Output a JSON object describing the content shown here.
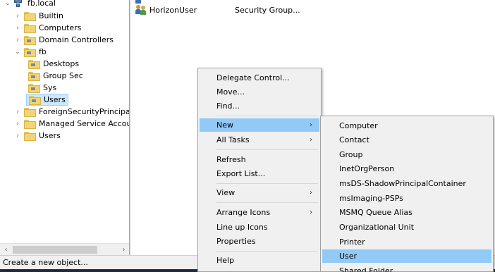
{
  "tree": {
    "domain": "fb.local",
    "items": [
      {
        "label": "Builtin"
      },
      {
        "label": "Computers"
      },
      {
        "label": "Domain Controllers"
      },
      {
        "label": "fb"
      },
      {
        "label": "Desktops"
      },
      {
        "label": "Group Sec"
      },
      {
        "label": "Sys"
      },
      {
        "label": "Users"
      },
      {
        "label": "ForeignSecurityPrincipals"
      },
      {
        "label": "Managed Service Accour"
      },
      {
        "label": "Users"
      }
    ]
  },
  "list": {
    "rows": [
      {
        "name": "HorizonUser",
        "type": "Security Group..."
      }
    ]
  },
  "context_menu": {
    "items": [
      "Delegate Control...",
      "Move...",
      "Find...",
      "New",
      "All Tasks",
      "Refresh",
      "Export List...",
      "View",
      "Arrange Icons",
      "Line up Icons",
      "Properties",
      "Help"
    ]
  },
  "new_submenu": {
    "items": [
      "Computer",
      "Contact",
      "Group",
      "InetOrgPerson",
      "msDS-ShadowPrincipalContainer",
      "msImaging-PSPs",
      "MSMQ Queue Alias",
      "Organizational Unit",
      "Printer",
      "User",
      "Shared Folder"
    ]
  },
  "status_bar": {
    "text": "Create a new object..."
  },
  "colors": {
    "menu_highlight": "#91c9f7",
    "tree_selection": "#cce8ff"
  }
}
